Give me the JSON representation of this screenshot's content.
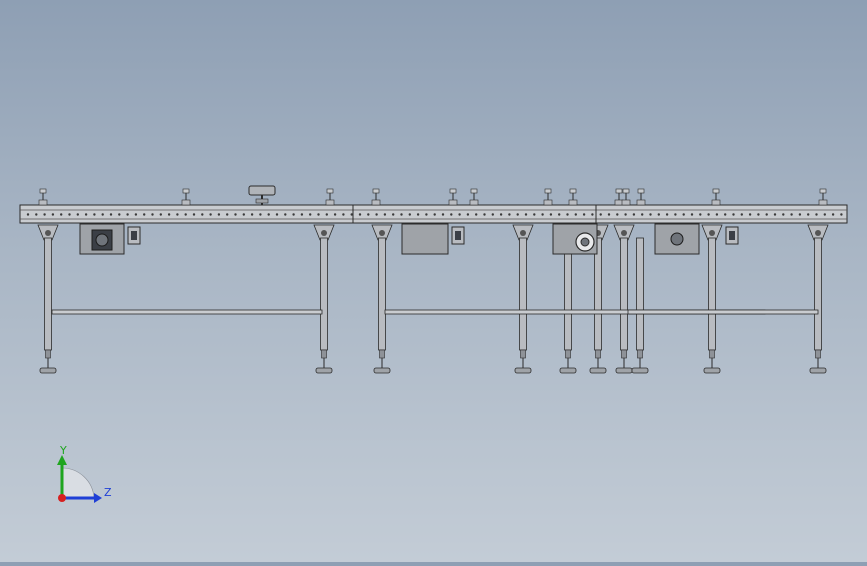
{
  "view": {
    "background_top": "#8e9fb4",
    "background_bottom": "#c3ccd6"
  },
  "triad": {
    "y_label": "Y",
    "z_label": "Z",
    "y_color": "#1fa51f",
    "z_color": "#1f3fd6",
    "x_color": "#d62020"
  },
  "model": {
    "frame_color": "#c9ccd0",
    "line_color": "#2b2b2b",
    "leg_color": "#b9bcc1",
    "panel_color": "#9fa3a8"
  }
}
